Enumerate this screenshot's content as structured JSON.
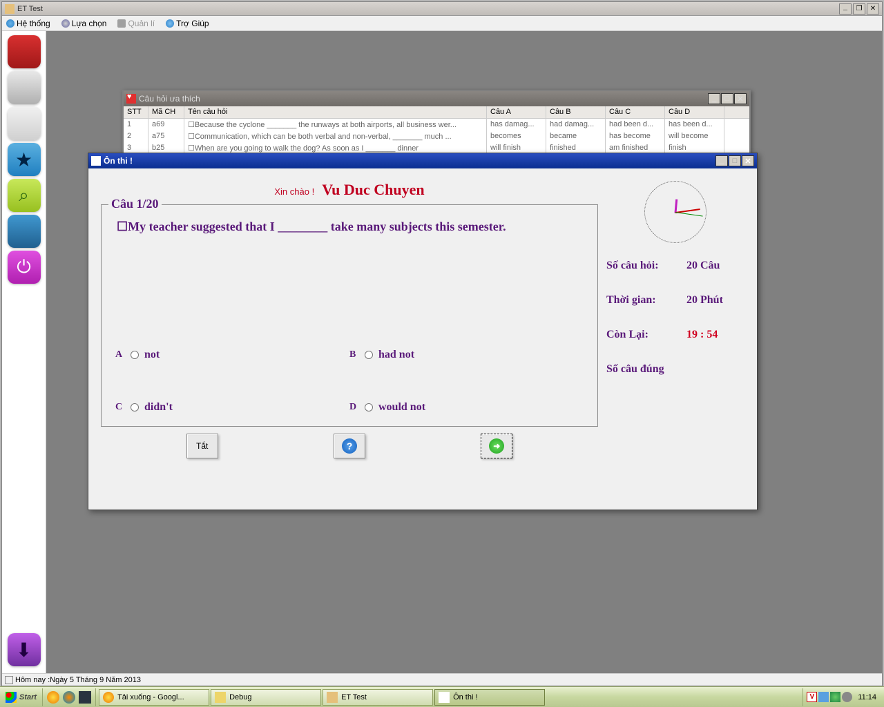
{
  "app": {
    "title": "ET Test"
  },
  "menu": {
    "system": "Hệ thống",
    "options": "Lựa chọn",
    "manage": "Quản lí",
    "help": "Trợ Giúp"
  },
  "fav_window": {
    "title": "Câu hỏi ưa thích",
    "headers": {
      "stt": "STT",
      "ma": "Mã CH",
      "ten": "Tên câu hỏi",
      "a": "Câu A",
      "b": "Câu B",
      "c": "Câu C",
      "d": "Câu D"
    },
    "rows": [
      {
        "stt": "1",
        "ma": "a69",
        "ten": "☐Because the cyclone _______ the runways at both airports, all business wer...",
        "a": "has damag...",
        "b": "had damag...",
        "c": "had been d...",
        "d": "has been d..."
      },
      {
        "stt": "2",
        "ma": "a75",
        "ten": "☐Communication, which can be both verbal and non-verbal, _______ much ...",
        "a": "becomes",
        "b": "became",
        "c": "has become",
        "d": "will become"
      },
      {
        "stt": "3",
        "ma": "b25",
        "ten": "☐When are you going to walk the dog? As soon as I _______ dinner",
        "a": "will finish",
        "b": "finished",
        "c": "am finished",
        "d": "finish"
      }
    ]
  },
  "exam_window": {
    "title": "Ôn thi !",
    "greeting": "Xin chào !",
    "username": "Vu Duc Chuyen",
    "question_label": "Câu  1/20",
    "question_text": "☐My teacher suggested that I ________ take many subjects this semester.",
    "answers": {
      "a": {
        "label": "A",
        "text": "not"
      },
      "b": {
        "label": "B",
        "text": "had not"
      },
      "c": {
        "label": "C",
        "text": "didn't"
      },
      "d": {
        "label": "D",
        "text": "would not"
      }
    },
    "buttons": {
      "off": "Tắt"
    },
    "stats": {
      "q_label": "Số câu hỏi:",
      "q_val": "20 Câu",
      "t_label": "Thời gian:",
      "t_val": "20 Phút",
      "r_label": "Còn Lại:",
      "r_val": "19 : 54",
      "c_label": "Số câu đúng"
    }
  },
  "statusbar": {
    "today": "Hôm nay :Ngày 5 Tháng 9 Năm 2013"
  },
  "taskbar": {
    "start": "Start",
    "tasks": [
      {
        "label": "Tải xuống - Googl..."
      },
      {
        "label": "Debug"
      },
      {
        "label": "ET Test"
      },
      {
        "label": "Ôn thi !"
      }
    ],
    "clock": "11:14",
    "tray_badge": "V"
  }
}
